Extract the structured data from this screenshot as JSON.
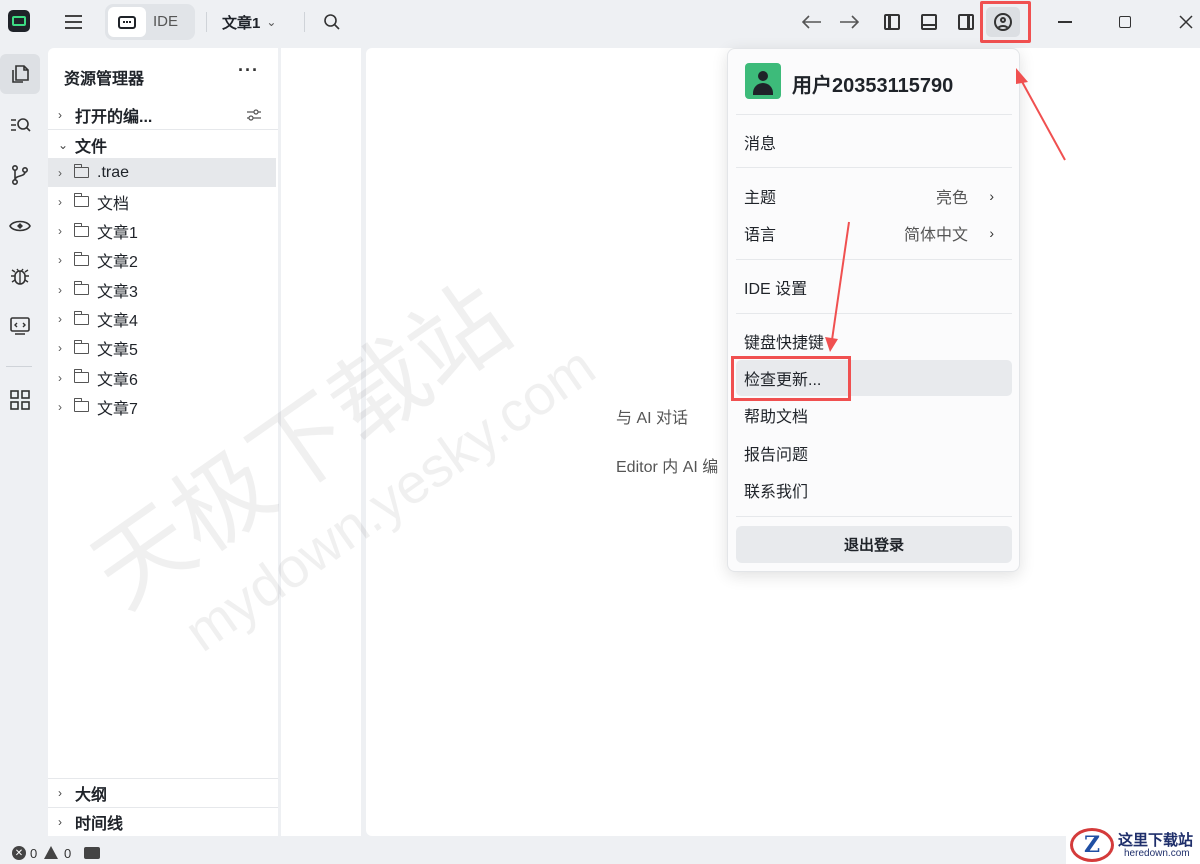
{
  "titlebar": {
    "mode_label": "IDE",
    "project_name": "文章1"
  },
  "explorer": {
    "title": "资源管理器",
    "more": "···",
    "open_editors_label": "打开的编...",
    "files_label": "文件",
    "items": [
      {
        "name": ".trae",
        "selected": true
      },
      {
        "name": "文档"
      },
      {
        "name": "文章1"
      },
      {
        "name": "文章2"
      },
      {
        "name": "文章3"
      },
      {
        "name": "文章4"
      },
      {
        "name": "文章5"
      },
      {
        "name": "文章6"
      },
      {
        "name": "文章7"
      }
    ],
    "outline_label": "大纲",
    "timeline_label": "时间线"
  },
  "editor": {
    "hint1": "与 AI 对话",
    "hint2": "Editor 内 AI 编"
  },
  "user_menu": {
    "username": "用户20353115790",
    "messages": "消息",
    "theme_label": "主题",
    "theme_value": "亮色",
    "language_label": "语言",
    "language_value": "简体中文",
    "ide_settings": "IDE 设置",
    "shortcuts": "键盘快捷键",
    "check_updates": "检查更新...",
    "help_docs": "帮助文档",
    "report_issue": "报告问题",
    "contact_us": "联系我们",
    "logout": "退出登录"
  },
  "status_bar": {
    "errors": "0",
    "warnings": "0"
  },
  "watermark": {
    "line1": "天极下载站",
    "line2": "mydown.yesky.com"
  },
  "corner_logo": {
    "title": "这里下载站",
    "subtitle": "heredown.com",
    "mark": "Z"
  },
  "colors": {
    "highlight": "#f05050",
    "avatar": "#3dbb7a",
    "background": "#eef0f3"
  }
}
